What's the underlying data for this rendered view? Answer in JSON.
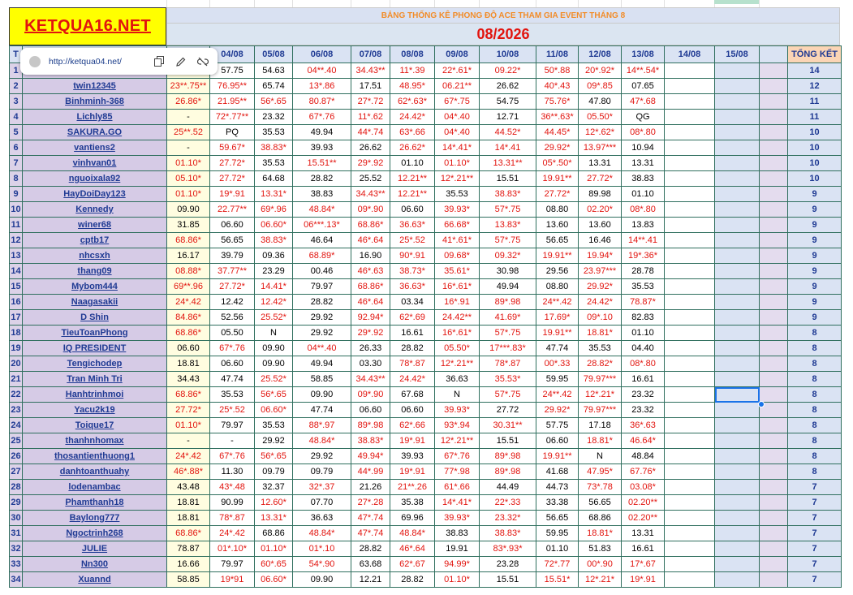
{
  "logo": {
    "text": "KETQUA16.NET"
  },
  "title": "BẢNG THỐNG KÊ PHONG ĐỘ ACE THAM GIA EVENT THÁNG 8",
  "month": "08/2026",
  "link_popup": {
    "url": "http://ketqua04.net/"
  },
  "columns": [
    "T",
    "",
    "04/08",
    "05/08",
    "06/08",
    "07/08",
    "08/08",
    "09/08",
    "10/08",
    "11/08",
    "12/08",
    "13/08",
    "14/08",
    "15/08",
    "",
    "TỔNG KẾT"
  ],
  "rows": [
    {
      "idx": "1",
      "name": "",
      "d": [
        "",
        "57.75",
        "54.63",
        "04**.40",
        "34.43**",
        "11*.39",
        "22*.61*",
        "09.22*",
        "50*.88",
        "20*.92*",
        "14**.54*"
      ],
      "total": "14"
    },
    {
      "idx": "2",
      "name": "twin12345",
      "d": [
        "23**.75**",
        "76.95**",
        "65.74",
        "13*.86",
        "17.51",
        "48.95*",
        "06.21**",
        "26.62",
        "40*.43",
        "09*.85",
        "07.65"
      ],
      "total": "12"
    },
    {
      "idx": "3",
      "name": "Binhminh-368",
      "d": [
        "26.86*",
        "21.95**",
        "56*.65",
        "80.87*",
        "27*.72",
        "62*.63*",
        "67*.75",
        "54.75",
        "75.76*",
        "47.80",
        "47*.68"
      ],
      "total": "11"
    },
    {
      "idx": "4",
      "name": "Lichly85",
      "d": [
        "-",
        "72*.77**",
        "23.32",
        "67*.76",
        "11*.62",
        "24.42*",
        "04*.40",
        "12.71",
        "36**.63*",
        "05.50*",
        "QG"
      ],
      "total": "11"
    },
    {
      "idx": "5",
      "name": "SAKURA.GO",
      "d": [
        "25**.52",
        "PQ",
        "35.53",
        "49.94",
        "44*.74",
        "63*.66",
        "04*.40",
        "44.52*",
        "44.45*",
        "12*.62*",
        "08*.80"
      ],
      "total": "10"
    },
    {
      "idx": "6",
      "name": "vantiens2",
      "d": [
        "-",
        "59.67*",
        "38.83*",
        "39.93",
        "26.62",
        "26.62*",
        "14*.41*",
        "14*.41",
        "29.92*",
        "13.97***",
        "10.94"
      ],
      "total": "10"
    },
    {
      "idx": "7",
      "name": "vinhvan01",
      "d": [
        "01.10*",
        "27.72*",
        "35.53",
        "15.51**",
        "29*.92",
        "01.10",
        "01.10*",
        "13.31**",
        "05*.50*",
        "13.31",
        "13.31"
      ],
      "total": "10"
    },
    {
      "idx": "8",
      "name": "nguoixala92",
      "d": [
        "05.10*",
        "27.72*",
        "64.68",
        "28.82",
        "25.52",
        "12.21**",
        "12*.21**",
        "15.51",
        "19.91**",
        "27.72*",
        "38.83"
      ],
      "total": "10"
    },
    {
      "idx": "9",
      "name": "HayDoiDay123",
      "d": [
        "01.10*",
        "19*.91",
        "13.31*",
        "38.83",
        "34.43**",
        "12.21**",
        "35.53",
        "38.83*",
        "27.72*",
        "89.98",
        "01.10"
      ],
      "total": "9"
    },
    {
      "idx": "10",
      "name": "Kennedy",
      "d": [
        "09.90",
        "22.77**",
        "69*.96",
        "48.84*",
        "09*.90",
        "06.60",
        "39.93*",
        "57*.75",
        "08.80",
        "02.20*",
        "08*.80"
      ],
      "total": "9"
    },
    {
      "idx": "11",
      "name": "winer68",
      "d": [
        "31.85",
        "06.60",
        "06.60*",
        "06***.13*",
        "68.86*",
        "36.63*",
        "66.68*",
        "13.83*",
        "13.60",
        "13.60",
        "13.83"
      ],
      "total": "9"
    },
    {
      "idx": "12",
      "name": "cptb17",
      "d": [
        "68.86*",
        "56.65",
        "38.83*",
        "46.64",
        "46*.64",
        "25*.52",
        "41*.61*",
        "57*.75",
        "56.65",
        "16.46",
        "14**.41"
      ],
      "total": "9"
    },
    {
      "idx": "13",
      "name": "nhcsxh",
      "d": [
        "16.17",
        "39.79",
        "09.36",
        "68.89*",
        "16.90",
        "90*.91",
        "09.68*",
        "09.32*",
        "19.91**",
        "19.94*",
        "19*.36*"
      ],
      "total": "9"
    },
    {
      "idx": "14",
      "name": "thang09",
      "d": [
        "08.88*",
        "37.77**",
        "23.29",
        "00.46",
        "46*.63",
        "38.73*",
        "35.61*",
        "30.98",
        "29.56",
        "23.97***",
        "28.78"
      ],
      "total": "9"
    },
    {
      "idx": "15",
      "name": "Mybom444",
      "d": [
        "69**.96",
        "27.72*",
        "14.41*",
        "79.97",
        "68.86*",
        "36.63*",
        "16*.61*",
        "49.94",
        "08.80",
        "29.92*",
        "35.53"
      ],
      "total": "9"
    },
    {
      "idx": "16",
      "name": "Naagasakii",
      "d": [
        "24*.42",
        "12.42",
        "12.42*",
        "28.82",
        "46*.64",
        "03.34",
        "16*.91",
        "89*.98",
        "24**.42",
        "24.42*",
        "78.87*"
      ],
      "total": "9"
    },
    {
      "idx": "17",
      "name": "D Shin",
      "d": [
        "84.86*",
        "52.56",
        "25.52*",
        "29.92",
        "92.94*",
        "62*.69",
        "24.42**",
        "41.69*",
        "17.69*",
        "09*.10",
        "82.83"
      ],
      "total": "9"
    },
    {
      "idx": "18",
      "name": "TieuToanPhong",
      "d": [
        "68.86*",
        "05.50",
        "N",
        "29.92",
        "29*.92",
        "16.61",
        "16*.61*",
        "57*.75",
        "19.91**",
        "18.81*",
        "01.10"
      ],
      "total": "8"
    },
    {
      "idx": "19",
      "name": "IQ PRESIDENT",
      "d": [
        "06.60",
        "67*.76",
        "09.90",
        "04**.40",
        "26.33",
        "28.82",
        "05.50*",
        "17***.83*",
        "47.74",
        "35.53",
        "04.40"
      ],
      "total": "8"
    },
    {
      "idx": "20",
      "name": "Tengichodep",
      "d": [
        "18.81",
        "06.60",
        "09.90",
        "49.94",
        "03.30",
        "78*.87",
        "12*.21**",
        "78*.87",
        "00*.33",
        "28.82*",
        "08*.80"
      ],
      "total": "8"
    },
    {
      "idx": "21",
      "name": "Tran Minh Tri",
      "d": [
        "34.43",
        "47.74",
        "25.52*",
        "58.85",
        "34.43**",
        "24.42*",
        "36.63",
        "35.53*",
        "59.95",
        "79.97***",
        "16.61"
      ],
      "total": "8"
    },
    {
      "idx": "22",
      "name": "Hanhtrinhmoi",
      "d": [
        "68.86*",
        "35.53",
        "56*.65",
        "09.90",
        "09*.90",
        "67.68",
        "N",
        "57*.75",
        "24**.42",
        "12*.21*",
        "23.32"
      ],
      "total": "8"
    },
    {
      "idx": "23",
      "name": "Yacu2k19",
      "d": [
        "27.72*",
        "25*.52",
        "06.60*",
        "47.74",
        "06.60",
        "06.60",
        "39.93*",
        "27.72",
        "29.92*",
        "79.97***",
        "23.32"
      ],
      "total": "8"
    },
    {
      "idx": "24",
      "name": "Toique17",
      "d": [
        "01.10*",
        "79.97",
        "35.53",
        "88*.97",
        "89*.98",
        "62*.66",
        "93*.94",
        "30.31**",
        "57.75",
        "17.18",
        "36*.63"
      ],
      "total": "8"
    },
    {
      "idx": "25",
      "name": "thanhnhomax",
      "d": [
        "-",
        "-",
        "29.92",
        "48.84*",
        "38.83*",
        "19*.91",
        "12*.21**",
        "15.51",
        "06.60",
        "18.81*",
        "46.64*"
      ],
      "total": "8"
    },
    {
      "idx": "26",
      "name": "thosantienthuong1",
      "d": [
        "24*.42",
        "67*.76",
        "56*.65",
        "29.92",
        "49.94*",
        "39.93",
        "67*.76",
        "89*.98",
        "19.91**",
        "N",
        "48.84"
      ],
      "total": "8"
    },
    {
      "idx": "27",
      "name": "danhtoanthuahy",
      "d": [
        "46*.88*",
        "11.30",
        "09.79",
        "09.79",
        "44*.99",
        "19*.91",
        "77*.98",
        "89*.98",
        "41.68",
        "47.95*",
        "67.76*"
      ],
      "total": "8"
    },
    {
      "idx": "28",
      "name": "lodenambac",
      "d": [
        "43.48",
        "43*.48",
        "32.37",
        "32*.37",
        "21.26",
        "21**.26",
        "61*.66",
        "44.49",
        "44.73",
        "73*.78",
        "03.08*"
      ],
      "total": "7"
    },
    {
      "idx": "29",
      "name": "Phamthanh18",
      "d": [
        "18.81",
        "90.99",
        "12.60*",
        "07.70",
        "27*.28",
        "35.38",
        "14*.41*",
        "22*.33",
        "33.38",
        "56.65",
        "02.20**"
      ],
      "total": "7"
    },
    {
      "idx": "30",
      "name": "Baylong777",
      "d": [
        "18.81",
        "78*.87",
        "13.31*",
        "36.63",
        "47*.74",
        "69.96",
        "39.93*",
        "23.32*",
        "56.65",
        "68.86",
        "02.20**"
      ],
      "total": "7"
    },
    {
      "idx": "31",
      "name": "Ngoctrinh268",
      "d": [
        "68.86*",
        "24*.42",
        "68.86",
        "48.84*",
        "47*.74",
        "48.84*",
        "38.83",
        "38.83*",
        "59.95",
        "18.81*",
        "13.31"
      ],
      "total": "7"
    },
    {
      "idx": "32",
      "name": "JULIE",
      "d": [
        "78.87",
        "01*.10*",
        "01.10*",
        "01*.10",
        "28.82",
        "46*.64",
        "19.91",
        "83*.93*",
        "01.10",
        "51.83",
        "16.61"
      ],
      "total": "7"
    },
    {
      "idx": "33",
      "name": "Nn300",
      "d": [
        "16.66",
        "79.97",
        "60*.65",
        "54*.90",
        "63.68",
        "62*.67",
        "94.99*",
        "23.28",
        "72*.77",
        "00*.90",
        "17*.67"
      ],
      "total": "7"
    },
    {
      "idx": "34",
      "name": "Xuannd",
      "d": [
        "58.85",
        "19*91",
        "06.60*",
        "09.90",
        "12.21",
        "28.82",
        "01.10*",
        "15.51",
        "15.51*",
        "12*.21*",
        "19*.91"
      ],
      "total": "7"
    }
  ]
}
